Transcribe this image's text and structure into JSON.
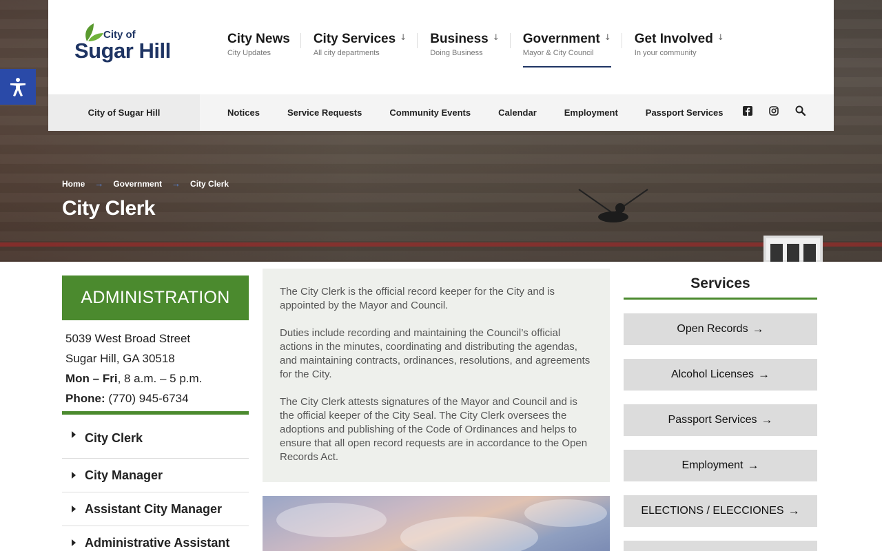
{
  "logo": {
    "line1": "City of",
    "line2": "Sugar Hill"
  },
  "main_nav": [
    {
      "title": "City News",
      "subtitle": "City Updates",
      "dropdown": false
    },
    {
      "title": "City Services",
      "subtitle": "All city departments",
      "dropdown": true
    },
    {
      "title": "Business",
      "subtitle": "Doing Business",
      "dropdown": true
    },
    {
      "title": "Government",
      "subtitle": "Mayor & City Council",
      "dropdown": true,
      "active": true
    },
    {
      "title": "Get Involved",
      "subtitle": "In your community",
      "dropdown": true
    }
  ],
  "subbar": {
    "home": "City of Sugar Hill",
    "links": [
      "Notices",
      "Service Requests",
      "Community Events",
      "Calendar",
      "Employment",
      "Passport Services"
    ],
    "icons": [
      "facebook-icon",
      "instagram-icon",
      "search-icon"
    ]
  },
  "accessibility": {
    "icon": "accessibility-icon"
  },
  "breadcrumb": {
    "items": [
      "Home",
      "Government",
      "City Clerk"
    ],
    "separator": "→"
  },
  "page_title": "City Clerk",
  "administration": {
    "heading": "ADMINISTRATION",
    "address_line1": "5039 West Broad Street",
    "address_line2": "Sugar Hill, GA 30518",
    "hours_label": "Mon – Fri",
    "hours_value": ", 8 a.m. – 5 p.m.",
    "phone_label": "Phone:",
    "phone_value": " (770) 945-6734"
  },
  "departments": [
    "City Clerk",
    "City Manager",
    "Assistant City Manager",
    "Administrative Assistant"
  ],
  "description": [
    "The City Clerk is the official record keeper for the City and is appointed by the Mayor and Council.",
    "Duties include recording and maintaining the Council’s official actions in the minutes, coordinating and distributing the agendas, and maintaining contracts, ordinances, resolutions, and agreements for the City.",
    "The City Clerk attests signatures of the Mayor and Council and is the official keeper of the City Seal. The City Clerk oversees the adoptions and publishing of the Code of Ordinances and helps to ensure that all open record requests are in accordance to the Open Records Act."
  ],
  "services": {
    "heading": "Services",
    "buttons": [
      "Open Records",
      "Alcohol Licenses",
      "Passport Services",
      "Employment",
      "ELECTIONS / ELECCIONES"
    ]
  },
  "colors": {
    "green": "#4b8a2e",
    "navy": "#1e3463",
    "a11y_blue": "#2a4aa8"
  }
}
